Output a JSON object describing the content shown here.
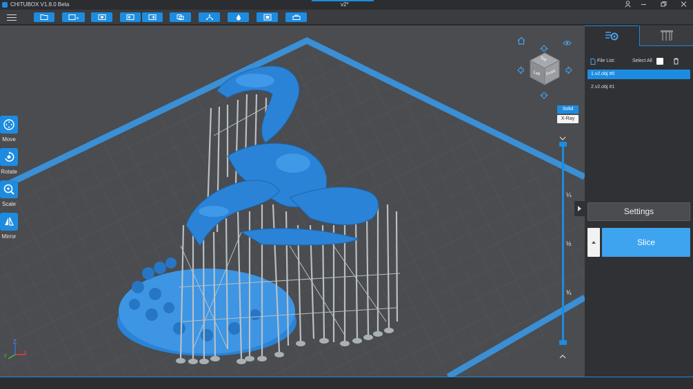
{
  "window": {
    "app_title": "CHITUBOX V1.8.0 Beta",
    "doc_title": "v2*",
    "controls": [
      "user-icon",
      "minimize-icon",
      "restore-icon",
      "close-icon"
    ]
  },
  "toolbar": {
    "buttons": [
      "open-file-icon",
      "save-icon",
      "auto-layout-icon",
      "undo-icon",
      "redo-icon",
      "copy-icon",
      "support-icon",
      "hollow-icon",
      "center-icon",
      "lock-icon"
    ]
  },
  "tools": [
    {
      "label": "Move",
      "icon": "move-icon"
    },
    {
      "label": "Rotate",
      "icon": "rotate-icon"
    },
    {
      "label": "Scale",
      "icon": "scale-icon"
    },
    {
      "label": "Mirror",
      "icon": "mirror-icon"
    }
  ],
  "view": {
    "solid_label": "Solid",
    "xray_label": "X-Ray",
    "cube_top": "Top",
    "cube_left": "Left",
    "cube_front": "Front"
  },
  "layer_slider": {
    "marks": [
      "¼",
      "½",
      "¾"
    ]
  },
  "right_panel": {
    "file_list_label": "File List:",
    "select_all_label": "Select All",
    "files": [
      {
        "name": "1.v2.obj #0",
        "selected": true
      },
      {
        "name": "2.v2.obj #1",
        "selected": false
      }
    ],
    "settings_label": "Settings",
    "slice_label": "Slice"
  },
  "axes": {
    "x": "X",
    "y": "Y",
    "z": "Z"
  },
  "colors": {
    "accent": "#1d8ce0",
    "model": "#2a83d6",
    "supports": "#b9c0c3",
    "viewport": "#4a4c50",
    "grid": "#57595d"
  }
}
